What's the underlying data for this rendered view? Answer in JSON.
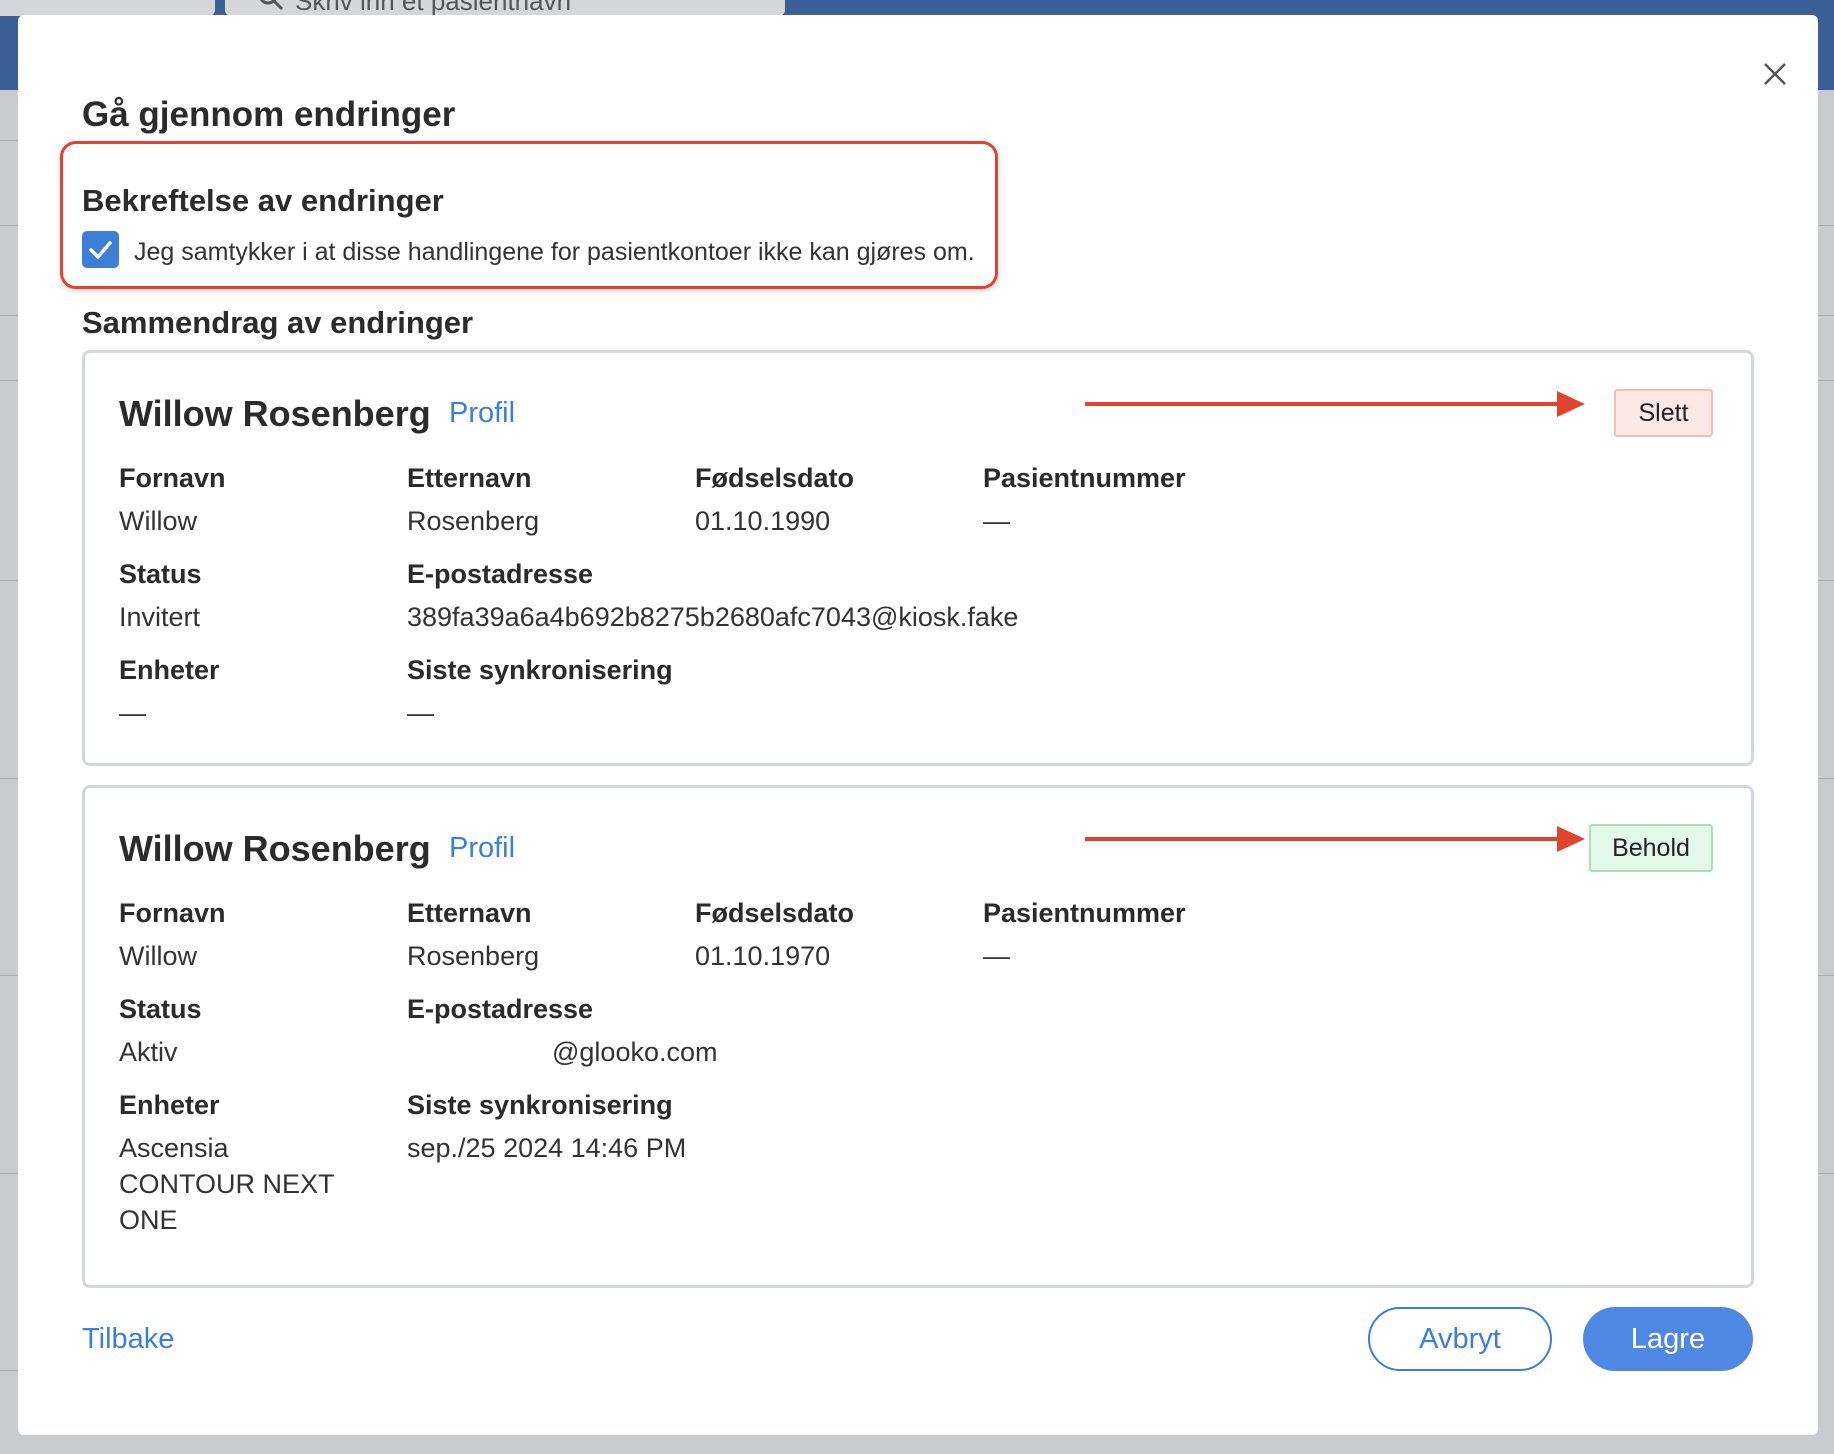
{
  "background": {
    "search_placeholder": "Skriv inn et pasientnavn"
  },
  "modal": {
    "title": "Gå gjennom endringer",
    "close_icon": "close-icon",
    "confirmation": {
      "title": "Bekreftelse av endringer",
      "checked": true,
      "consent_text": "Jeg samtykker i at disse handlingene for pasientkontoer ikke kan gjøres om."
    },
    "summary_title": "Sammendrag av endringer",
    "labels": {
      "first_name": "Fornavn",
      "last_name": "Etternavn",
      "birth_date": "Fødselsdato",
      "patient_number": "Pasientnummer",
      "status": "Status",
      "email": "E-postadresse",
      "devices": "Enheter",
      "last_sync": "Siste synkronisering"
    },
    "patients": [
      {
        "name": "Willow Rosenberg",
        "profile_link": "Profil",
        "action": "Slett",
        "first_name": "Willow",
        "last_name": "Rosenberg",
        "birth_date": "01.10.1990",
        "patient_number": "—",
        "status": "Invitert",
        "email": "389fa39a6a4b692b8275b2680afc7043@kiosk.fake",
        "devices": "—",
        "last_sync": "—"
      },
      {
        "name": "Willow Rosenberg",
        "profile_link": "Profil",
        "action": "Behold",
        "first_name": "Willow",
        "last_name": "Rosenberg",
        "birth_date": "01.10.1970",
        "patient_number": "—",
        "status": "Aktiv",
        "email": "@glooko.com",
        "devices": "Ascensia CONTOUR NEXT ONE",
        "last_sync": "sep./25 2024 14:46 PM"
      }
    ],
    "footer": {
      "back_label": "Tilbake",
      "cancel_label": "Avbryt",
      "save_label": "Lagre"
    }
  },
  "colors": {
    "accent": "#3d7fd6",
    "highlight": "#e2432e",
    "delete_bg": "#fde8e6",
    "keep_bg": "#e4f8ea"
  }
}
